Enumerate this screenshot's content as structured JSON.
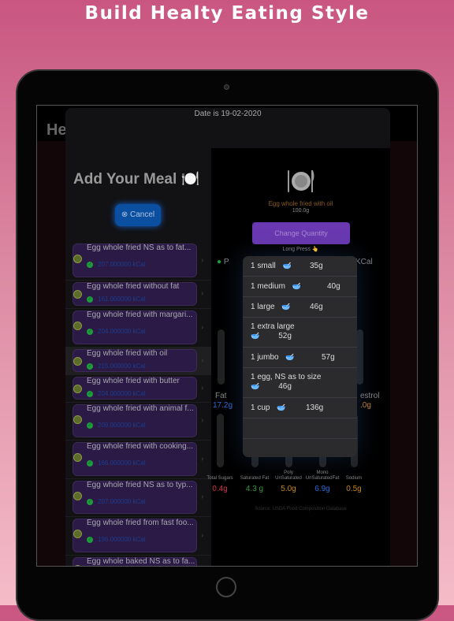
{
  "banner_title": "Build Healty Eating Style",
  "background_screen": {
    "title_partial": "He"
  },
  "modal": {
    "date": "Date is 19-02-2020",
    "title": "Add Your Meal 🍽️",
    "cancel_label": "Cancel",
    "foods": [
      {
        "name": "Egg whole fried NS as to fat...",
        "kcal": "207.000000 kCal"
      },
      {
        "name": "Egg whole fried without fat",
        "kcal": "161.000000 kCal"
      },
      {
        "name": "Egg whole fried with margari...",
        "kcal": "204.000000 kCal"
      },
      {
        "name": "Egg whole fried with oil",
        "kcal": "215.000000 kCal",
        "selected": true
      },
      {
        "name": "Egg whole fried with butter",
        "kcal": "204.000000 kCal"
      },
      {
        "name": "Egg whole fried with animal f...",
        "kcal": "209.000000 kCal"
      },
      {
        "name": "Egg whole fried with cooking...",
        "kcal": "166.000000 kCal"
      },
      {
        "name": "Egg whole fried NS as to typ...",
        "kcal": "207.000000 kCal"
      },
      {
        "name": "Egg whole fried from fast foo...",
        "kcal": "196.000000 kCal"
      },
      {
        "name": "Egg whole baked NS as to fa...",
        "kcal": "168.000000 kCal"
      }
    ]
  },
  "detail": {
    "food_name": "Egg whole fried with oil",
    "quantity": "100.0g",
    "change_quantity_label": "Change Quantity",
    "long_press_hint": "Long Press 👆",
    "partial_left": "P",
    "partial_right": "KCal",
    "fat_label": "Fat",
    "fat_value": "17.2g",
    "cholesterol_partial": "estrol",
    "cholesterol_value_partial": ".0g",
    "nutrients": [
      {
        "label": "Total Sugars",
        "value": "0.4g",
        "color": "#d0304a"
      },
      {
        "label": "Saturated Fat",
        "value": "4.3 g",
        "color": "#2f9a3a"
      },
      {
        "label": "Poly UnSaturated",
        "value": "5.0g",
        "color": "#c8841a"
      },
      {
        "label": "Mono UnSaturatedFat",
        "value": "6.9g",
        "color": "#2a6ad8"
      },
      {
        "label": "Sodium",
        "value": "0.5g",
        "color": "#c8841a"
      }
    ],
    "source": "Source: USDA Food Composition Database"
  },
  "quantity_options": [
    {
      "label": "1 small",
      "grams": "35g"
    },
    {
      "label": "1 medium",
      "grams": "40g"
    },
    {
      "label": "1 large",
      "grams": "46g"
    },
    {
      "label": "1 extra large",
      "grams": "52g"
    },
    {
      "label": "1 jumbo",
      "grams": "57g"
    },
    {
      "label": "1 egg, NS as to size",
      "grams": "46g"
    },
    {
      "label": "1 cup",
      "grams": "136g"
    }
  ]
}
